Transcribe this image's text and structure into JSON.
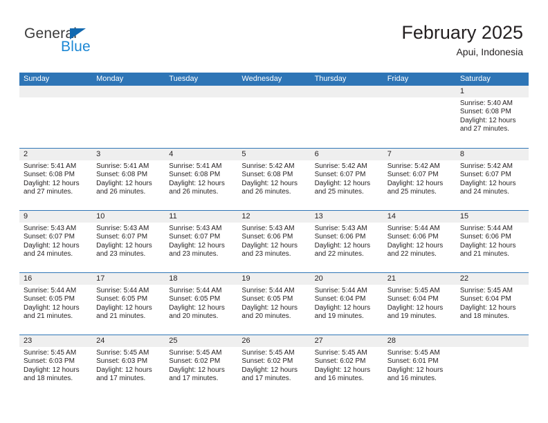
{
  "brand": {
    "name_part1": "General",
    "name_part2": "Blue",
    "triangle_color": "#1269b0",
    "blue_color": "#1b87d4"
  },
  "header": {
    "title": "February 2025",
    "subtitle": "Apui, Indonesia",
    "accent_color": "#2e75b6",
    "band_color": "#efefef"
  },
  "weekdays": [
    "Sunday",
    "Monday",
    "Tuesday",
    "Wednesday",
    "Thursday",
    "Friday",
    "Saturday"
  ],
  "weeks": [
    [
      {
        "day": "",
        "sunrise": "",
        "sunset": "",
        "daylight": "",
        "daylight2": ""
      },
      {
        "day": "",
        "sunrise": "",
        "sunset": "",
        "daylight": "",
        "daylight2": ""
      },
      {
        "day": "",
        "sunrise": "",
        "sunset": "",
        "daylight": "",
        "daylight2": ""
      },
      {
        "day": "",
        "sunrise": "",
        "sunset": "",
        "daylight": "",
        "daylight2": ""
      },
      {
        "day": "",
        "sunrise": "",
        "sunset": "",
        "daylight": "",
        "daylight2": ""
      },
      {
        "day": "",
        "sunrise": "",
        "sunset": "",
        "daylight": "",
        "daylight2": ""
      },
      {
        "day": "1",
        "sunrise": "Sunrise: 5:40 AM",
        "sunset": "Sunset: 6:08 PM",
        "daylight": "Daylight: 12 hours",
        "daylight2": "and 27 minutes."
      }
    ],
    [
      {
        "day": "2",
        "sunrise": "Sunrise: 5:41 AM",
        "sunset": "Sunset: 6:08 PM",
        "daylight": "Daylight: 12 hours",
        "daylight2": "and 27 minutes."
      },
      {
        "day": "3",
        "sunrise": "Sunrise: 5:41 AM",
        "sunset": "Sunset: 6:08 PM",
        "daylight": "Daylight: 12 hours",
        "daylight2": "and 26 minutes."
      },
      {
        "day": "4",
        "sunrise": "Sunrise: 5:41 AM",
        "sunset": "Sunset: 6:08 PM",
        "daylight": "Daylight: 12 hours",
        "daylight2": "and 26 minutes."
      },
      {
        "day": "5",
        "sunrise": "Sunrise: 5:42 AM",
        "sunset": "Sunset: 6:08 PM",
        "daylight": "Daylight: 12 hours",
        "daylight2": "and 26 minutes."
      },
      {
        "day": "6",
        "sunrise": "Sunrise: 5:42 AM",
        "sunset": "Sunset: 6:07 PM",
        "daylight": "Daylight: 12 hours",
        "daylight2": "and 25 minutes."
      },
      {
        "day": "7",
        "sunrise": "Sunrise: 5:42 AM",
        "sunset": "Sunset: 6:07 PM",
        "daylight": "Daylight: 12 hours",
        "daylight2": "and 25 minutes."
      },
      {
        "day": "8",
        "sunrise": "Sunrise: 5:42 AM",
        "sunset": "Sunset: 6:07 PM",
        "daylight": "Daylight: 12 hours",
        "daylight2": "and 24 minutes."
      }
    ],
    [
      {
        "day": "9",
        "sunrise": "Sunrise: 5:43 AM",
        "sunset": "Sunset: 6:07 PM",
        "daylight": "Daylight: 12 hours",
        "daylight2": "and 24 minutes."
      },
      {
        "day": "10",
        "sunrise": "Sunrise: 5:43 AM",
        "sunset": "Sunset: 6:07 PM",
        "daylight": "Daylight: 12 hours",
        "daylight2": "and 23 minutes."
      },
      {
        "day": "11",
        "sunrise": "Sunrise: 5:43 AM",
        "sunset": "Sunset: 6:07 PM",
        "daylight": "Daylight: 12 hours",
        "daylight2": "and 23 minutes."
      },
      {
        "day": "12",
        "sunrise": "Sunrise: 5:43 AM",
        "sunset": "Sunset: 6:06 PM",
        "daylight": "Daylight: 12 hours",
        "daylight2": "and 23 minutes."
      },
      {
        "day": "13",
        "sunrise": "Sunrise: 5:43 AM",
        "sunset": "Sunset: 6:06 PM",
        "daylight": "Daylight: 12 hours",
        "daylight2": "and 22 minutes."
      },
      {
        "day": "14",
        "sunrise": "Sunrise: 5:44 AM",
        "sunset": "Sunset: 6:06 PM",
        "daylight": "Daylight: 12 hours",
        "daylight2": "and 22 minutes."
      },
      {
        "day": "15",
        "sunrise": "Sunrise: 5:44 AM",
        "sunset": "Sunset: 6:06 PM",
        "daylight": "Daylight: 12 hours",
        "daylight2": "and 21 minutes."
      }
    ],
    [
      {
        "day": "16",
        "sunrise": "Sunrise: 5:44 AM",
        "sunset": "Sunset: 6:05 PM",
        "daylight": "Daylight: 12 hours",
        "daylight2": "and 21 minutes."
      },
      {
        "day": "17",
        "sunrise": "Sunrise: 5:44 AM",
        "sunset": "Sunset: 6:05 PM",
        "daylight": "Daylight: 12 hours",
        "daylight2": "and 21 minutes."
      },
      {
        "day": "18",
        "sunrise": "Sunrise: 5:44 AM",
        "sunset": "Sunset: 6:05 PM",
        "daylight": "Daylight: 12 hours",
        "daylight2": "and 20 minutes."
      },
      {
        "day": "19",
        "sunrise": "Sunrise: 5:44 AM",
        "sunset": "Sunset: 6:05 PM",
        "daylight": "Daylight: 12 hours",
        "daylight2": "and 20 minutes."
      },
      {
        "day": "20",
        "sunrise": "Sunrise: 5:44 AM",
        "sunset": "Sunset: 6:04 PM",
        "daylight": "Daylight: 12 hours",
        "daylight2": "and 19 minutes."
      },
      {
        "day": "21",
        "sunrise": "Sunrise: 5:45 AM",
        "sunset": "Sunset: 6:04 PM",
        "daylight": "Daylight: 12 hours",
        "daylight2": "and 19 minutes."
      },
      {
        "day": "22",
        "sunrise": "Sunrise: 5:45 AM",
        "sunset": "Sunset: 6:04 PM",
        "daylight": "Daylight: 12 hours",
        "daylight2": "and 18 minutes."
      }
    ],
    [
      {
        "day": "23",
        "sunrise": "Sunrise: 5:45 AM",
        "sunset": "Sunset: 6:03 PM",
        "daylight": "Daylight: 12 hours",
        "daylight2": "and 18 minutes."
      },
      {
        "day": "24",
        "sunrise": "Sunrise: 5:45 AM",
        "sunset": "Sunset: 6:03 PM",
        "daylight": "Daylight: 12 hours",
        "daylight2": "and 17 minutes."
      },
      {
        "day": "25",
        "sunrise": "Sunrise: 5:45 AM",
        "sunset": "Sunset: 6:02 PM",
        "daylight": "Daylight: 12 hours",
        "daylight2": "and 17 minutes."
      },
      {
        "day": "26",
        "sunrise": "Sunrise: 5:45 AM",
        "sunset": "Sunset: 6:02 PM",
        "daylight": "Daylight: 12 hours",
        "daylight2": "and 17 minutes."
      },
      {
        "day": "27",
        "sunrise": "Sunrise: 5:45 AM",
        "sunset": "Sunset: 6:02 PM",
        "daylight": "Daylight: 12 hours",
        "daylight2": "and 16 minutes."
      },
      {
        "day": "28",
        "sunrise": "Sunrise: 5:45 AM",
        "sunset": "Sunset: 6:01 PM",
        "daylight": "Daylight: 12 hours",
        "daylight2": "and 16 minutes."
      },
      {
        "day": "",
        "sunrise": "",
        "sunset": "",
        "daylight": "",
        "daylight2": ""
      }
    ]
  ]
}
